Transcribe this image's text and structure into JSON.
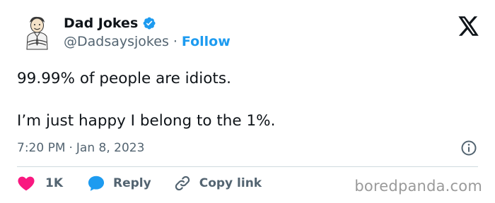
{
  "author": {
    "display_name": "Dad Jokes",
    "handle": "@Dadsaysjokes",
    "separator": "·",
    "follow_label": "Follow"
  },
  "tweet": {
    "line1": "99.99% of people are idiots.",
    "line2": "I’m just happy I belong to the 1%.",
    "time": "7:20 PM",
    "separator": "·",
    "date": "Jan 8, 2023"
  },
  "actions": {
    "like_count": "1K",
    "reply_label": "Reply",
    "copy_label": "Copy link"
  },
  "watermark": "boredpanda.com",
  "colors": {
    "accent": "#1d9bf0",
    "like": "#f91880",
    "text": "#0f1419",
    "secondary": "#536471"
  },
  "icons": {
    "avatar": "cartoon-dad-avatar",
    "verified": "verified-badge-icon",
    "logo": "x-logo-icon",
    "info": "info-icon",
    "like": "heart-icon",
    "reply": "speech-bubble-icon",
    "copy": "link-icon"
  }
}
